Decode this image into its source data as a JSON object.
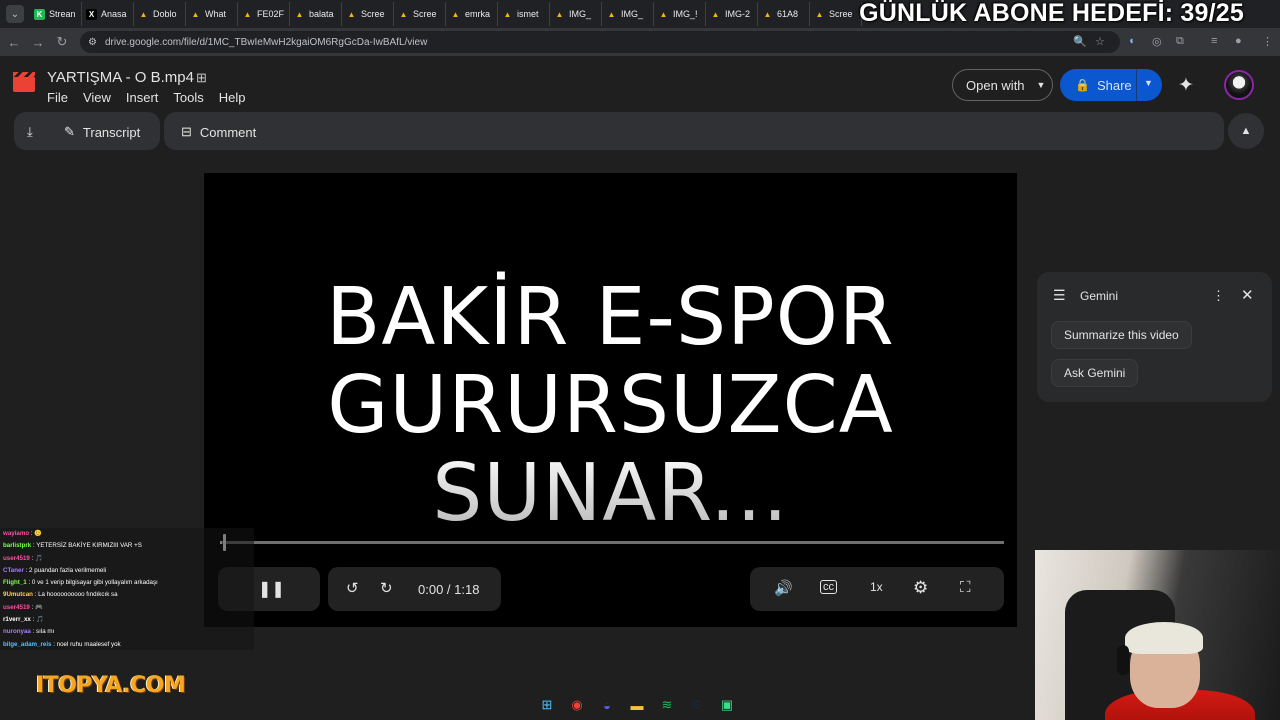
{
  "browser": {
    "tabs": [
      {
        "label": "Strean",
        "icon": "twitch-icon",
        "color": "#1db954"
      },
      {
        "label": "Anasa",
        "icon": "x-icon",
        "color": "#000000"
      },
      {
        "label": "Doblo",
        "icon": "drive-icon",
        "color": "#f4b400"
      },
      {
        "label": "What",
        "icon": "drive-icon",
        "color": "#f4b400"
      },
      {
        "label": "FE02F",
        "icon": "drive-icon",
        "color": "#f4b400"
      },
      {
        "label": "balata",
        "icon": "drive-icon",
        "color": "#f4b400"
      },
      {
        "label": "Scree",
        "icon": "drive-icon",
        "color": "#f4b400"
      },
      {
        "label": "Scree",
        "icon": "drive-icon",
        "color": "#f4b400"
      },
      {
        "label": "emrka",
        "icon": "drive-icon",
        "color": "#f4b400"
      },
      {
        "label": "ismet",
        "icon": "drive-icon",
        "color": "#f4b400"
      },
      {
        "label": "IMG_",
        "icon": "drive-icon",
        "color": "#f4b400"
      },
      {
        "label": "IMG_",
        "icon": "drive-icon",
        "color": "#f4b400"
      },
      {
        "label": "IMG_!",
        "icon": "drive-icon",
        "color": "#f4b400"
      },
      {
        "label": "IMG-2",
        "icon": "drive-icon",
        "color": "#f4b400"
      },
      {
        "label": "61A8",
        "icon": "drive-icon",
        "color": "#f4b400"
      },
      {
        "label": "Scree",
        "icon": "drive-icon",
        "color": "#f4b400"
      }
    ],
    "url": "drive.google.com/file/d/1MC_TBwIeMwH2kgaiOM6RgGcDa-IwBAfL/view"
  },
  "overlay_goal": "GÜNLÜK ABONE HEDEFİ: 39/25",
  "drive": {
    "file_name": "YARTIŞMA - O B.mp4",
    "menu": [
      "File",
      "View",
      "Insert",
      "Tools",
      "Help"
    ],
    "open_with": "Open with",
    "share": "Share",
    "transcript": "Transcript",
    "comment": "Comment"
  },
  "video": {
    "title_lines": [
      "BAKİR E-SPOR",
      "GURURSUZCA",
      "SUNAR..."
    ],
    "time": "0:00 / 1:18",
    "speed": "1x",
    "progress_fraction": 0.003
  },
  "gemini": {
    "title": "Gemini",
    "suggestions": [
      "Summarize this video",
      "Ask Gemini"
    ]
  },
  "chat": [
    {
      "user": "wayiamo",
      "msg": "🙂",
      "color": "#ff4fa3"
    },
    {
      "user": "barlistprk",
      "msg": "YETERSİZ BAKİYE KIRMIZIII VAR +S",
      "color": "#7cff4f"
    },
    {
      "user": "user4519",
      "msg": "🎵",
      "color": "#ff4fa3"
    },
    {
      "user": "CTaner",
      "msg": "2 puandan fazla verilmemeli",
      "color": "#a77bff"
    },
    {
      "user": "Flight_1",
      "msg": "0 ve 1 verip bilgisayar gibi yollayalım arkadaşı",
      "color": "#7cff4f"
    },
    {
      "user": "9Umutcan",
      "msg": "La hoooooooooo fındıkcık sa",
      "color": "#ffd24f"
    },
    {
      "user": "user4519",
      "msg": "🎮",
      "color": "#ff4fa3"
    },
    {
      "user": "r1verr_xx",
      "msg": "🎵",
      "color": "#ffffff"
    },
    {
      "user": "nuronyaa",
      "msg": "sıla mı",
      "color": "#a77bff"
    },
    {
      "user": "bilge_adam_reis",
      "msg": "noel ruhu maalesef yok",
      "color": "#4fc3ff"
    }
  ],
  "logo_text": "ITOPYA.COM",
  "taskbar": [
    {
      "icon": "windows-icon",
      "color": "#4cc2ff"
    },
    {
      "icon": "chrome-icon",
      "color": "#ea4335"
    },
    {
      "icon": "discord-icon",
      "color": "#5865f2"
    },
    {
      "icon": "folder-icon",
      "color": "#f4c242"
    },
    {
      "icon": "spotify-icon",
      "color": "#1db954"
    },
    {
      "icon": "steam-icon",
      "color": "#1b2838"
    },
    {
      "icon": "app-icon",
      "color": "#3ddc84"
    }
  ]
}
